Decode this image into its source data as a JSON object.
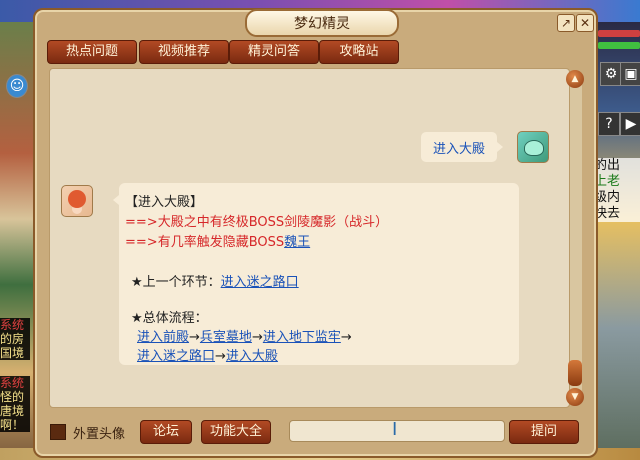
{
  "window": {
    "title": "梦幻精灵"
  },
  "tabs": [
    {
      "label": "热点问题"
    },
    {
      "label": "视频推荐"
    },
    {
      "label": "精灵问答",
      "active": true
    },
    {
      "label": "攻略站"
    }
  ],
  "chat": {
    "player_message": "进入大殿",
    "npc": {
      "heading": "【进入大殿】",
      "arrow": "==>",
      "line1": "大殿之中有终极BOSS剑陵魔影（战斗）",
      "line2_prefix": "有几率触发隐藏BOSS",
      "line2_link": "魏王",
      "prev_label": "★上一个环节：",
      "prev_link": "进入迷之路口",
      "flow_label": "★总体流程：",
      "flow_step1": "进入前殿",
      "flow_step2": "兵室墓地",
      "flow_step3": "进入地下监牢",
      "flow_step4": "进入迷之路口",
      "flow_step5": "进入大殿",
      "flow_arrow": "→"
    }
  },
  "bottom": {
    "avatar_toggle_label": "外置头像",
    "forum_button": "论坛",
    "features_button": "功能大全",
    "ask_input_value": "",
    "ask_button": "提问"
  },
  "background": {
    "right_text": [
      "的出",
      "上老",
      "级内",
      "快去"
    ],
    "left_text": [
      "系统",
      "的房",
      "国境",
      "系统",
      "怪的",
      "唐境",
      "啊！"
    ],
    "help_label": "?"
  },
  "colors": {
    "accent": "#8a3a10",
    "link": "#1a52b8",
    "highlight_red": "#d6282a",
    "panel": "#c9ab7c"
  }
}
